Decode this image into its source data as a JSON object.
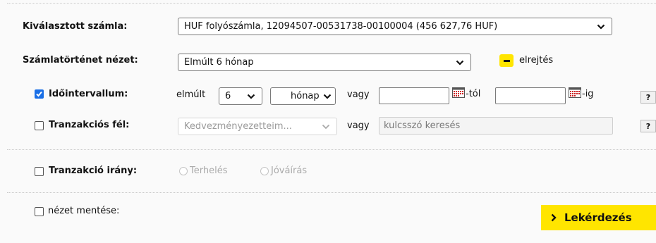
{
  "account": {
    "label": "Kiválasztott számla:",
    "selected": "HUF folyószámla, 12094507-00531738-00100004 (456 627,76 HUF)"
  },
  "history_view": {
    "label": "Számlatörténet nézet:",
    "selected": "Elmúlt 6 hónap",
    "hide_label": "elrejtés"
  },
  "interval": {
    "label": "Időintervallum:",
    "checked": true,
    "prefix": "elmúlt",
    "amount": "6",
    "unit": "hónap",
    "or": "vagy",
    "from_suffix": "-tól",
    "to_suffix": "-ig",
    "help": "?"
  },
  "party": {
    "label": "Tranzakciós fél:",
    "checked": false,
    "select_placeholder": "Kedvezményezetteim...",
    "or": "vagy",
    "search_placeholder": "kulcsszó keresés",
    "help": "?"
  },
  "direction": {
    "label": "Tranzakció irány:",
    "checked": false,
    "options": [
      "Terhelés",
      "Jóváírás"
    ]
  },
  "save_view": {
    "label": "nézet mentése:",
    "checked": false
  },
  "submit": {
    "label": "Lekérdezés"
  },
  "colors": {
    "accent": "#ffe500",
    "checkbox": "#1a6fe6"
  },
  "icons": [
    "chevron-down-icon",
    "minus-icon",
    "calendar-icon",
    "chevron-right-icon",
    "checkmark-icon"
  ]
}
